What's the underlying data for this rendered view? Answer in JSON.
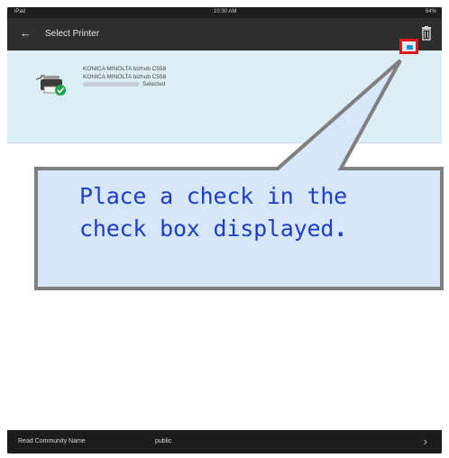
{
  "status_bar": {
    "left": "iPad",
    "time": "10:30 AM",
    "battery": "64%"
  },
  "app_bar": {
    "title": "Select Printer",
    "back_icon": "arrow-left-icon",
    "trash_icon": "trash-icon"
  },
  "printer": {
    "name": "KONICA MINOLTA bizhub C558",
    "model": "KONICA MINOLTA bizhub C558",
    "status": "Selected",
    "icon": "printer-check-icon"
  },
  "bottom_bar": {
    "label": "Read Community Name",
    "value": "public",
    "chevron_icon": "chevron-right-icon"
  },
  "callout": {
    "line1": "Place a check in the",
    "line2": "check box displayed",
    "period": "."
  },
  "colors": {
    "row_highlight": "#dbedf5",
    "checkbox": "#1e8fd0",
    "highlight_border": "#e8141c",
    "callout_fill": "#d6e6fb",
    "callout_text": "#1f3dcc"
  }
}
